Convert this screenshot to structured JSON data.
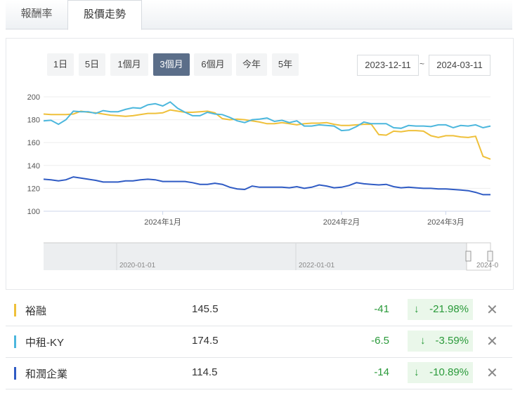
{
  "tabs": [
    {
      "label": "報酬率"
    },
    {
      "label": "股價走勢"
    }
  ],
  "ranges": [
    "1日",
    "5日",
    "1個月",
    "3個月",
    "6個月",
    "今年",
    "5年"
  ],
  "active_range": "3個月",
  "date_from": "2023-12-11",
  "date_sep": "~",
  "date_to": "2024-03-11",
  "navigator": {
    "labels": [
      "2020-01-01",
      "2022-01-01",
      "2024-0"
    ]
  },
  "chart_data": {
    "type": "line",
    "ylim": [
      100,
      200
    ],
    "yticks": [
      100,
      120,
      140,
      160,
      180,
      200
    ],
    "xticks": [
      {
        "index": 16,
        "label": "2024年1月"
      },
      {
        "index": 40,
        "label": "2024年2月"
      },
      {
        "index": 54,
        "label": "2024年3月"
      }
    ],
    "series": [
      {
        "name": "裕融",
        "color": "#efc03a",
        "values": [
          185,
          184.5,
          184.5,
          184.5,
          185,
          187.5,
          186.5,
          186,
          185,
          184,
          183.5,
          183,
          183.5,
          184.5,
          185.5,
          185.5,
          186,
          188.5,
          187.5,
          186.5,
          186.5,
          187,
          187.5,
          186,
          181,
          180,
          180.5,
          180,
          179,
          178,
          176.5,
          176.5,
          177.5,
          176.5,
          175.5,
          176.5,
          177,
          177,
          177.5,
          176,
          175,
          175,
          175.5,
          176,
          176,
          167,
          166.5,
          170,
          169.5,
          170.5,
          170.5,
          170,
          166,
          164.5,
          166,
          166,
          165,
          164.5,
          165.5,
          148,
          145.5
        ]
      },
      {
        "name": "中租-KY",
        "color": "#4cb7dd",
        "values": [
          179,
          179.5,
          176,
          180,
          187.5,
          187,
          187,
          185.5,
          188,
          187,
          187,
          189,
          190.5,
          190,
          193,
          194,
          192,
          195.5,
          190,
          186.5,
          183.5,
          183.5,
          186.5,
          185,
          184.5,
          182,
          179,
          177.5,
          180,
          180.5,
          181.5,
          178.5,
          179.5,
          177.5,
          179,
          174.5,
          174.5,
          175.5,
          175,
          174.5,
          170.5,
          171,
          174,
          178,
          176.5,
          176.5,
          176.5,
          173,
          172.5,
          175,
          174.5,
          174.5,
          174,
          175.5,
          175.5,
          173,
          175,
          174.5,
          175.5,
          173,
          174.5
        ]
      },
      {
        "name": "和潤企業",
        "color": "#2f5bc4",
        "values": [
          128,
          127.5,
          126.5,
          127.5,
          130,
          129,
          128,
          127,
          125.5,
          125.5,
          125.5,
          126.5,
          126.5,
          127.5,
          128,
          127.5,
          126,
          126,
          126,
          126,
          125,
          123.5,
          123.5,
          124.5,
          123.5,
          121,
          119.5,
          119,
          122,
          121,
          121,
          121,
          121,
          120.5,
          121.5,
          120,
          121,
          123,
          122,
          120.5,
          121,
          122.5,
          125,
          124,
          123.5,
          123,
          123.5,
          121.5,
          120.5,
          121,
          120.5,
          120,
          120,
          119.5,
          119.5,
          119,
          118.5,
          118,
          116.5,
          114.5,
          114.5
        ]
      }
    ]
  },
  "rows": [
    {
      "name": "裕融",
      "price": "145.5",
      "change": "-41",
      "pct": "-21.98%",
      "arrow": "↓"
    },
    {
      "name": "中租-KY",
      "price": "174.5",
      "change": "-6.5",
      "pct": "-3.59%",
      "arrow": "↓"
    },
    {
      "name": "和潤企業",
      "price": "114.5",
      "change": "-14",
      "pct": "-10.89%",
      "arrow": "↓"
    }
  ]
}
